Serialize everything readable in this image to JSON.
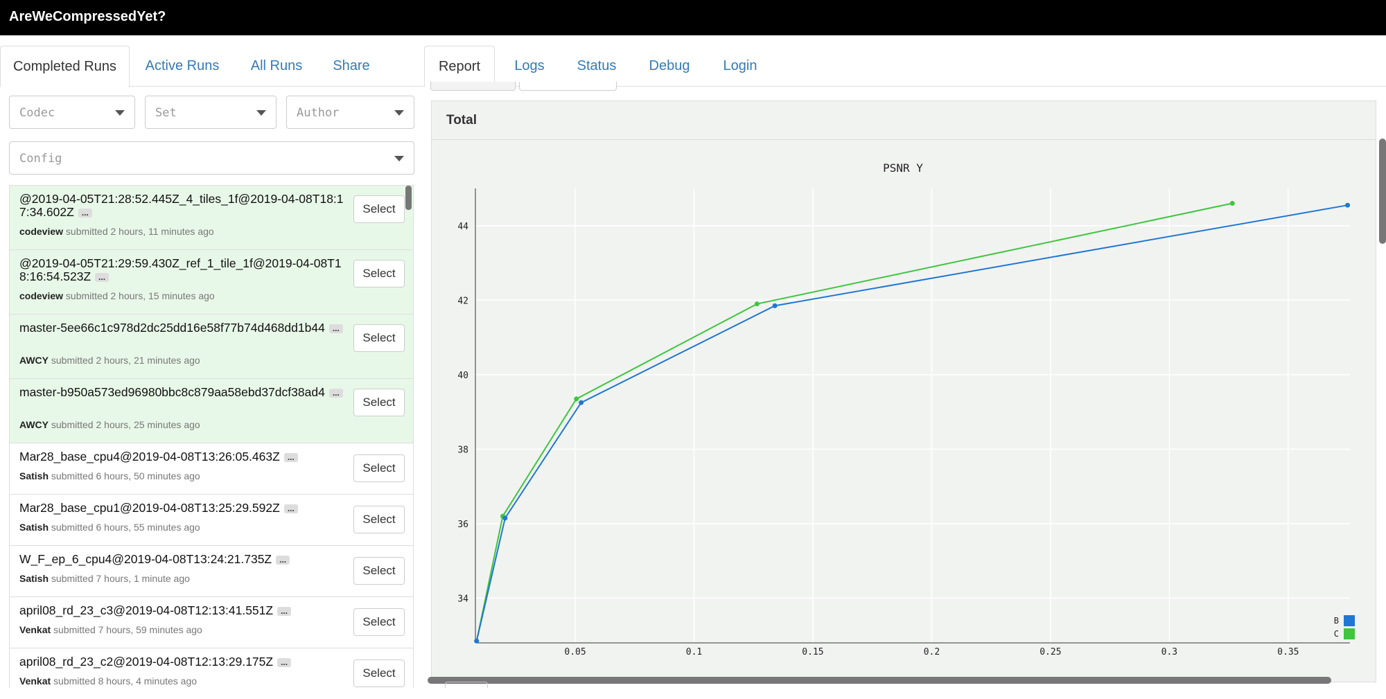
{
  "app": {
    "title": "AreWeCompressedYet?"
  },
  "left_tabs": [
    {
      "label": "Completed Runs",
      "active": true
    },
    {
      "label": "Active Runs",
      "active": false
    },
    {
      "label": "All Runs",
      "active": false
    },
    {
      "label": "Share",
      "active": false
    }
  ],
  "right_tabs": [
    {
      "label": "Report",
      "active": true
    },
    {
      "label": "Logs",
      "active": false
    },
    {
      "label": "Status",
      "active": false
    },
    {
      "label": "Debug",
      "active": false
    },
    {
      "label": "Login",
      "active": false
    }
  ],
  "filters": {
    "codec": "Codec",
    "set": "Set",
    "author": "Author",
    "config": "Config"
  },
  "runs": [
    {
      "name": "@2019-04-05T21:28:52.445Z_4_tiles_1f@2019-04-08T18:17:34.602Z",
      "author": "codeview",
      "when": " submitted 2 hours, 11 minutes ago",
      "selected": true,
      "button": "Select"
    },
    {
      "name": "@2019-04-05T21:29:59.430Z_ref_1_tile_1f@2019-04-08T18:16:54.523Z",
      "author": "codeview",
      "when": " submitted 2 hours, 15 minutes ago",
      "selected": true,
      "button": "Select"
    },
    {
      "name": "master-5ee66c1c978d2dc25dd16e58f77b74d468dd1b44",
      "author": "AWCY",
      "when": " submitted 2 hours, 21 minutes ago",
      "selected": true,
      "button": "Select"
    },
    {
      "name": "master-b950a573ed96980bbc8c879aa58ebd37dcf38ad4",
      "author": "AWCY",
      "when": " submitted 2 hours, 25 minutes ago",
      "selected": true,
      "button": "Select"
    },
    {
      "name": "Mar28_base_cpu4@2019-04-08T13:26:05.463Z",
      "author": "Satish",
      "when": " submitted 6 hours, 50 minutes ago",
      "selected": false,
      "button": "Select"
    },
    {
      "name": "Mar28_base_cpu1@2019-04-08T13:25:29.592Z",
      "author": "Satish",
      "when": " submitted 6 hours, 55 minutes ago",
      "selected": false,
      "button": "Select"
    },
    {
      "name": "W_F_ep_6_cpu4@2019-04-08T13:24:21.735Z",
      "author": "Satish",
      "when": " submitted 7 hours, 1 minute ago",
      "selected": false,
      "button": "Select"
    },
    {
      "name": "april08_rd_23_c3@2019-04-08T12:13:41.551Z",
      "author": "Venkat",
      "when": " submitted 7 hours, 59 minutes ago",
      "selected": false,
      "button": "Select"
    },
    {
      "name": "april08_rd_23_c2@2019-04-08T12:13:29.175Z",
      "author": "Venkat",
      "when": " submitted 8 hours, 4 minutes ago",
      "selected": false,
      "button": "Select"
    }
  ],
  "dots_label": "...",
  "panel": {
    "title": "Total"
  },
  "chart_data": {
    "type": "line",
    "title": "PSNR Y",
    "xlabel": "",
    "ylabel": "",
    "xlim": [
      0.008,
      0.376
    ],
    "ylim": [
      32.8,
      45.0
    ],
    "xticks": [
      0.05,
      0.1,
      0.15,
      0.2,
      0.25,
      0.3,
      0.35
    ],
    "xtick_labels": [
      "0.05",
      "0.1",
      "0.15",
      "0.2",
      "0.25",
      "0.3",
      "0.35"
    ],
    "yticks": [
      34,
      36,
      38,
      40,
      42,
      44
    ],
    "ytick_labels": [
      "34",
      "36",
      "38",
      "40",
      "42",
      "44"
    ],
    "grid": true,
    "legend_position": "bottom-right",
    "series": [
      {
        "name": "B",
        "color": "#1f77d4",
        "x": [
          0.0085,
          0.0205,
          0.0525,
          0.134,
          0.375
        ],
        "y": [
          32.85,
          36.15,
          39.25,
          41.85,
          44.55
        ]
      },
      {
        "name": "C",
        "color": "#3ec63e",
        "x": [
          0.0085,
          0.0195,
          0.0505,
          0.1265,
          0.3265
        ],
        "y": [
          32.85,
          36.2,
          39.35,
          41.9,
          44.6
        ]
      }
    ]
  }
}
